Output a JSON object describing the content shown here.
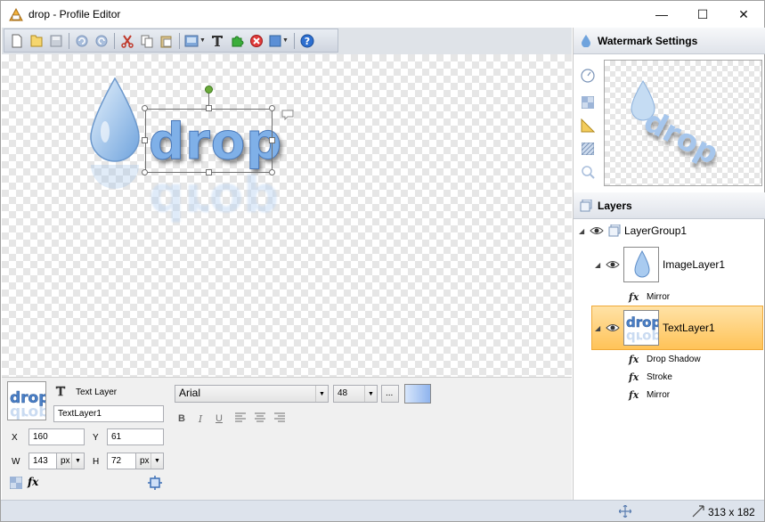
{
  "window": {
    "title": "drop - Profile Editor",
    "minimize": "—",
    "maximize": "☐",
    "close": "✕"
  },
  "canvas": {
    "logo_text": "drop"
  },
  "properties": {
    "layer_type": "Text Layer",
    "layer_name": "TextLayer1",
    "x_label": "X",
    "x_value": "160",
    "y_label": "Y",
    "y_value": "61",
    "w_label": "W",
    "w_value": "143",
    "h_label": "H",
    "h_value": "72",
    "unit": "px",
    "font_family": "Arial",
    "font_size": "48",
    "more_label": "...",
    "bold_label": "B",
    "italic_label": "I",
    "underline_label": "U",
    "text_color": "#8fb4ee",
    "thumb_text": "drop"
  },
  "watermark_settings": {
    "title": "Watermark Settings",
    "preview_text": "drop"
  },
  "layers": {
    "title": "Layers",
    "items": [
      {
        "name": "LayerGroup1"
      },
      {
        "name": "ImageLayer1"
      },
      {
        "name": "Mirror"
      },
      {
        "name": "TextLayer1"
      },
      {
        "name": "Drop Shadow"
      },
      {
        "name": "Stroke"
      },
      {
        "name": "Mirror"
      }
    ],
    "thumb_text": "drop"
  },
  "status": {
    "size": "313 x 182"
  },
  "colors": {
    "accent_blue": "#5b8fd6",
    "selection_orange": "#ffc358"
  }
}
